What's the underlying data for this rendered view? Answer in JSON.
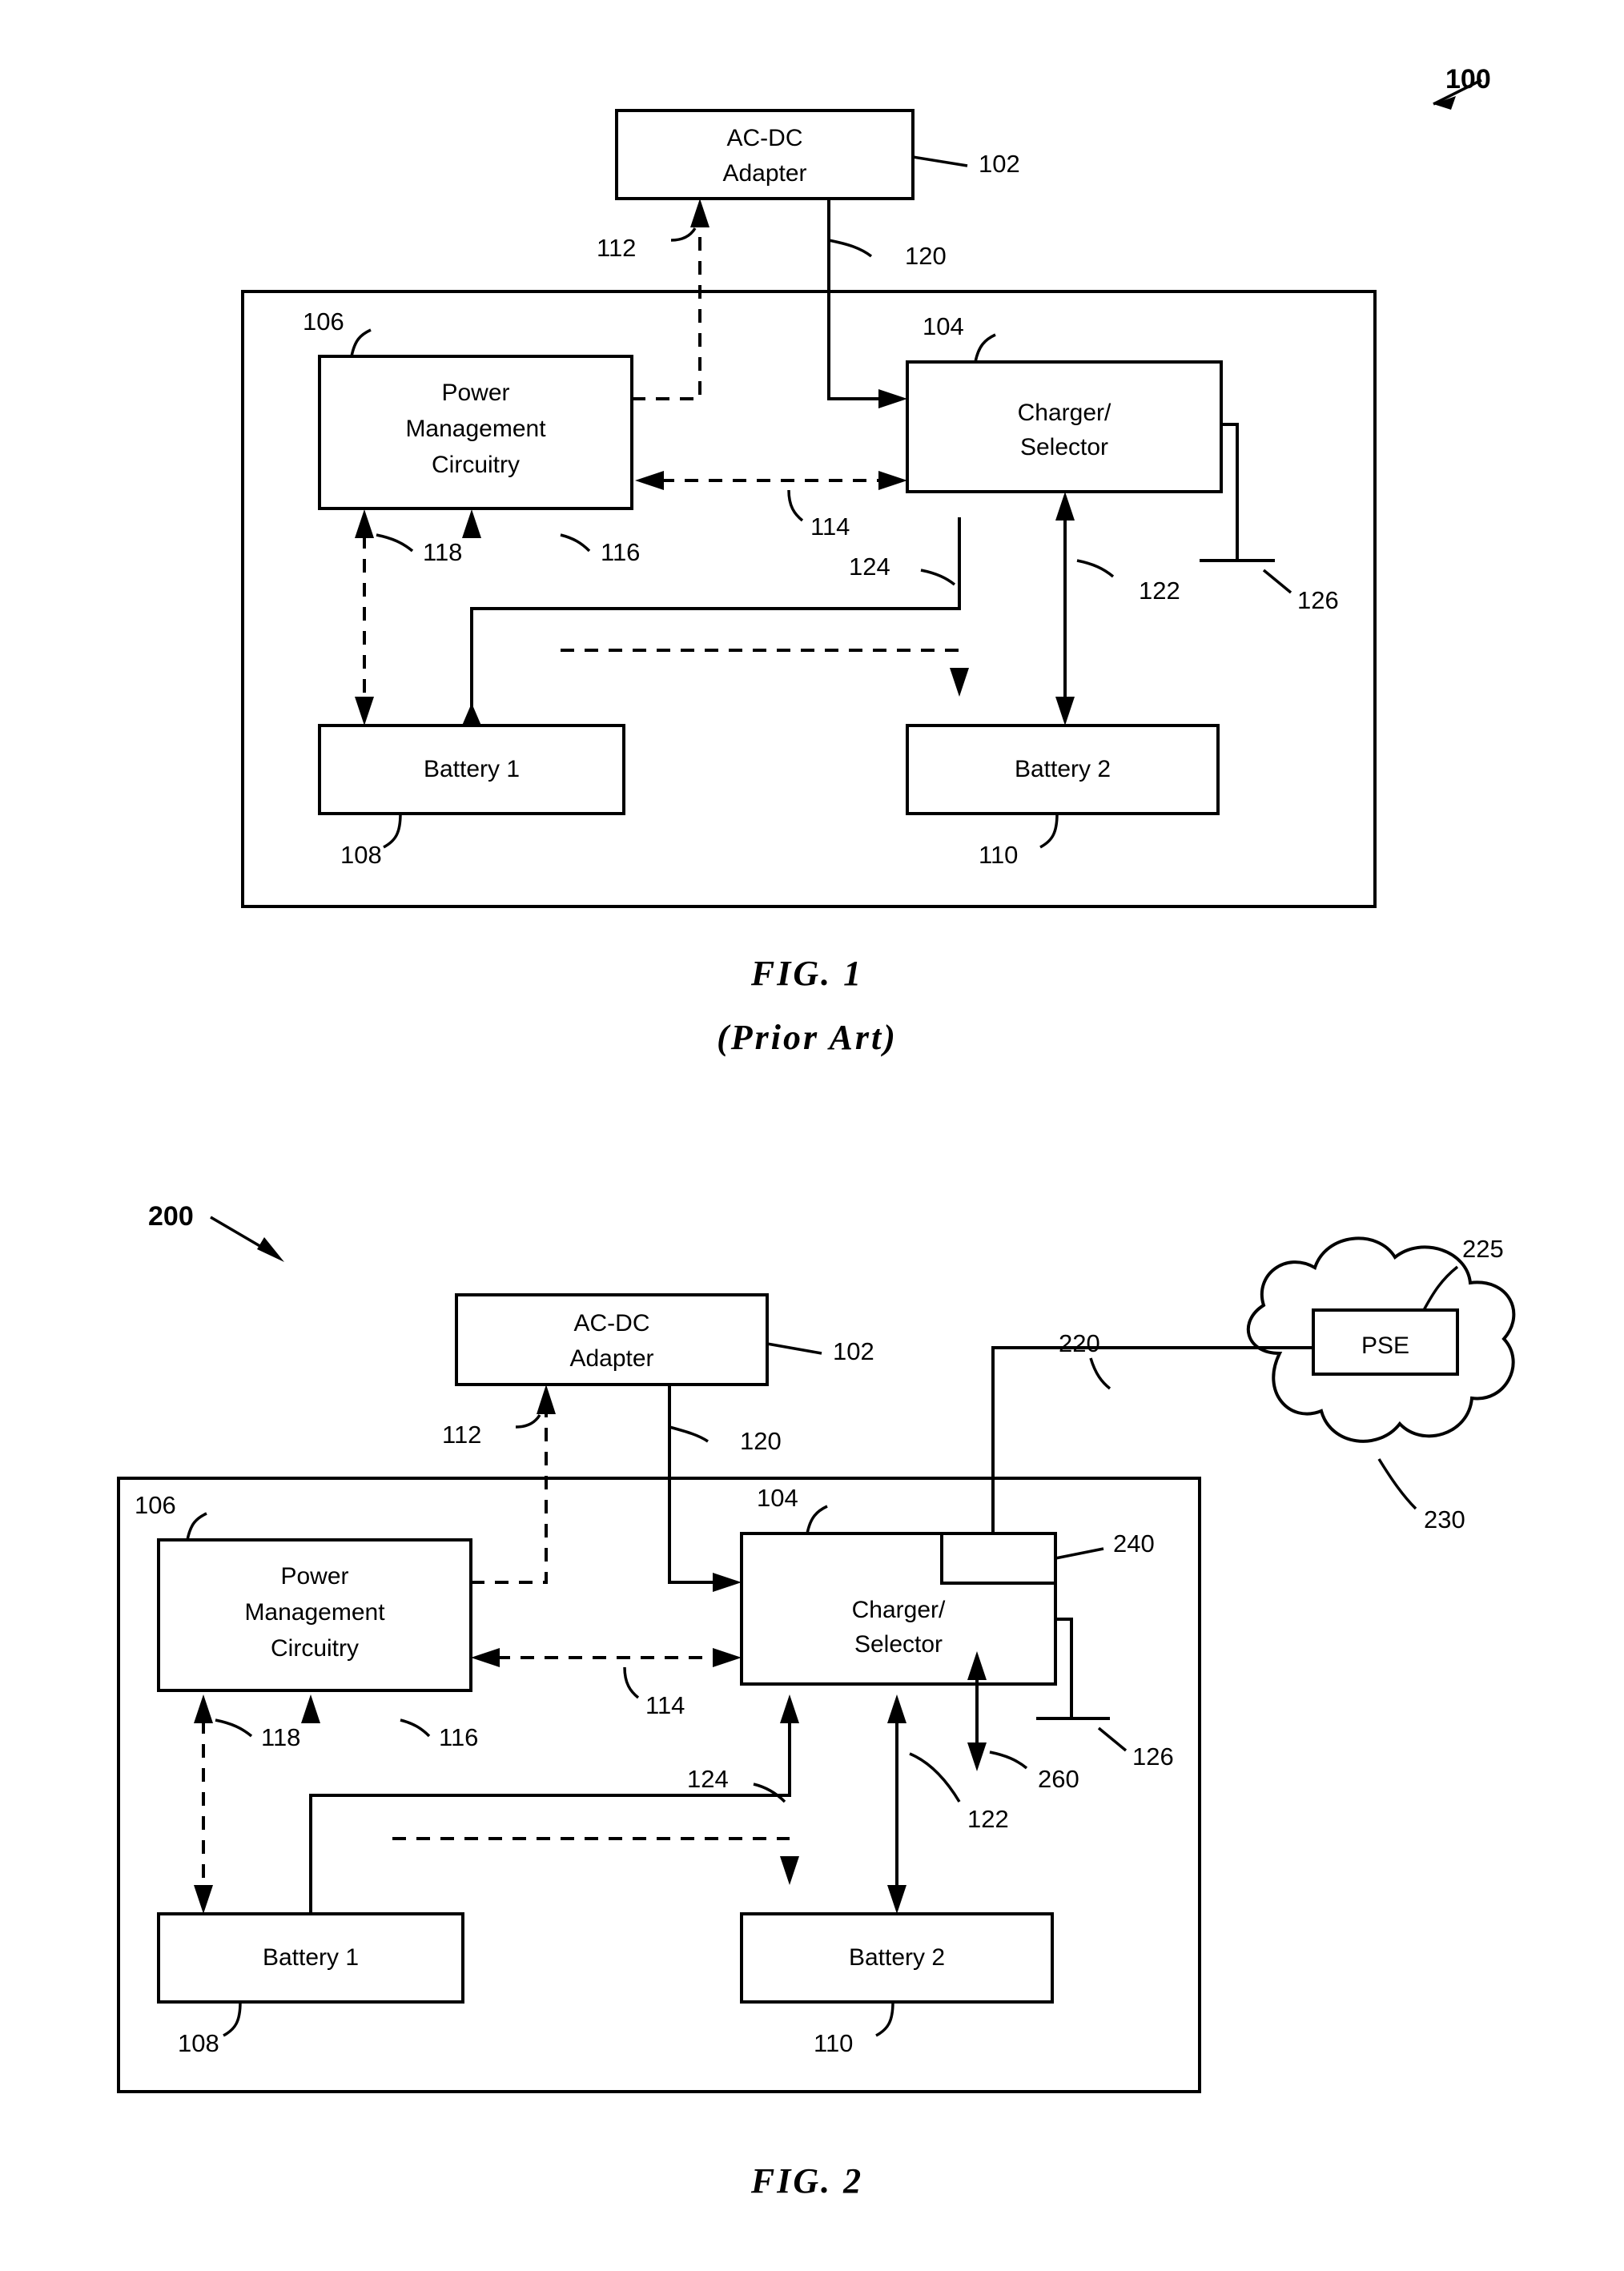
{
  "document": {
    "type": "patent-drawing-sheet",
    "figures": [
      {
        "id": "fig1",
        "caption_line1": "FIG.  1",
        "caption_line2": "(Prior  Art)",
        "system_ref": "100",
        "blocks": [
          {
            "id": "adapter",
            "label_line1": "AC-DC",
            "label_line2": "Adapter",
            "ref": "102"
          },
          {
            "id": "pmc",
            "label_line1": "Power",
            "label_line2": "Management",
            "label_line3": "Circuitry",
            "ref": "106"
          },
          {
            "id": "charger",
            "label_line1": "Charger/",
            "label_line2": "Selector",
            "ref": "104"
          },
          {
            "id": "battery1",
            "label_line1": "Battery 1",
            "ref": "108"
          },
          {
            "id": "battery2",
            "label_line1": "Battery 2",
            "ref": "110"
          }
        ],
        "connection_refs": [
          "112",
          "120",
          "114",
          "116",
          "118",
          "124",
          "122",
          "126"
        ]
      },
      {
        "id": "fig2",
        "caption_line1": "FIG.  2",
        "system_ref": "200",
        "blocks": [
          {
            "id": "adapter",
            "label_line1": "AC-DC",
            "label_line2": "Adapter",
            "ref": "102"
          },
          {
            "id": "pmc",
            "label_line1": "Power",
            "label_line2": "Management",
            "label_line3": "Circuitry",
            "ref": "106"
          },
          {
            "id": "charger",
            "label_line1": "Charger/",
            "label_line2": "Selector",
            "ref": "104"
          },
          {
            "id": "battery1",
            "label_line1": "Battery 1",
            "ref": "108"
          },
          {
            "id": "battery2",
            "label_line1": "Battery 2",
            "ref": "110"
          },
          {
            "id": "pse",
            "label_line1": "PSE",
            "ref": "225"
          },
          {
            "id": "cloud",
            "ref": "230"
          },
          {
            "id": "pd_interface",
            "ref": "240"
          }
        ],
        "connection_refs": [
          "112",
          "120",
          "114",
          "116",
          "118",
          "124",
          "122",
          "126",
          "220",
          "260"
        ]
      }
    ]
  },
  "labels": {
    "ac_dc_line1": "AC-DC",
    "ac_dc_line2": "Adapter",
    "power_line1": "Power",
    "power_line2": "Management",
    "power_line3": "Circuitry",
    "charger_line1": "Charger/",
    "charger_line2": "Selector",
    "battery1": "Battery 1",
    "battery2": "Battery 2",
    "pse": "PSE",
    "ref_100": "100",
    "ref_200": "200",
    "ref_102": "102",
    "ref_104": "104",
    "ref_106": "106",
    "ref_108": "108",
    "ref_110": "110",
    "ref_112": "112",
    "ref_114": "114",
    "ref_116": "116",
    "ref_118": "118",
    "ref_120": "120",
    "ref_122": "122",
    "ref_124": "124",
    "ref_126": "126",
    "ref_220": "220",
    "ref_225": "225",
    "ref_230": "230",
    "ref_240": "240",
    "ref_260": "260",
    "fig1_caption": "FIG.  1",
    "fig1_subcaption": "(Prior  Art)",
    "fig2_caption": "FIG.  2"
  }
}
